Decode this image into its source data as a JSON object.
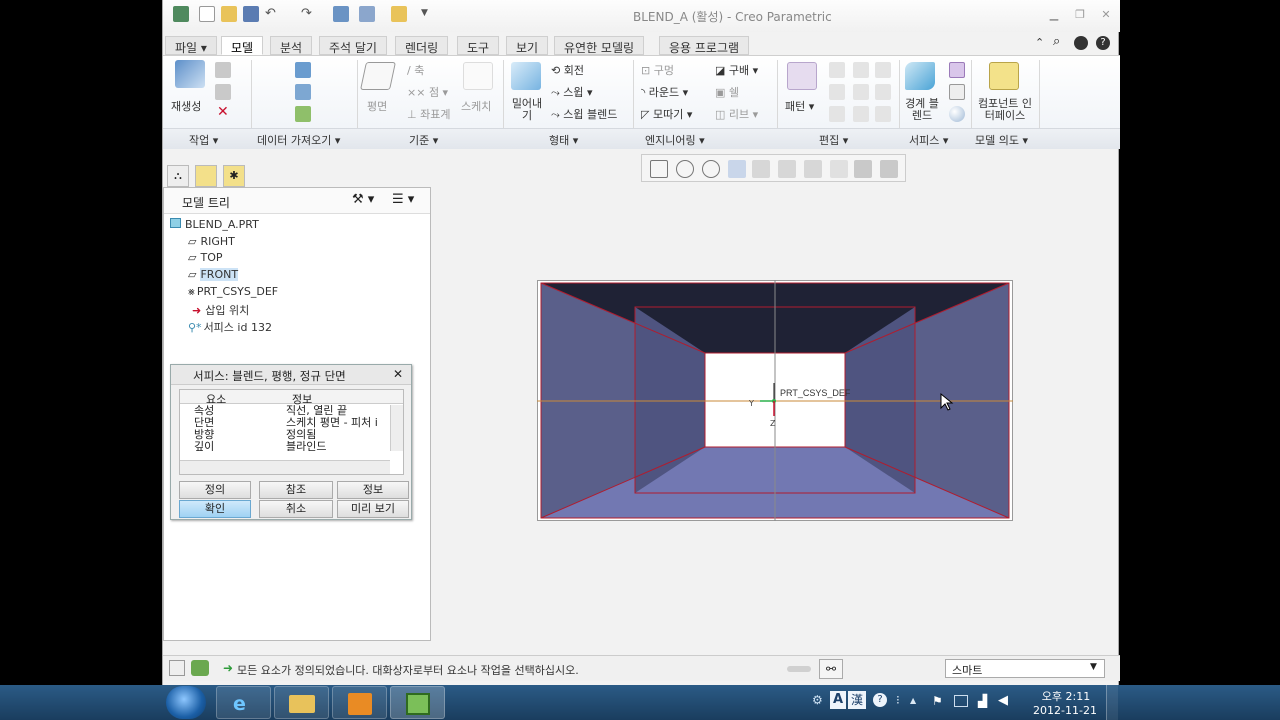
{
  "window": {
    "title": "BLEND_A (활성) - Creo Parametric",
    "controls": [
      "minimize-icon",
      "restore-icon",
      "close-icon"
    ]
  },
  "tabs": {
    "file": "파일",
    "model": "모델",
    "analysis": "분석",
    "annotate": "주석 달기",
    "render": "렌더링",
    "tools": "도구",
    "view": "보기",
    "flexible": "유연한 모델링",
    "apps": "응용 프로그램"
  },
  "ribbon": {
    "regenerate": "재생성",
    "plane": "평면",
    "axis": "축",
    "point": "점",
    "csys": "좌표계",
    "sketch": "스케치",
    "extrude": "밀어내기",
    "revolve": "회전",
    "sweep": "스윕",
    "swept_blend": "스윕 블렌드",
    "hole": "구멍",
    "round": "라운드",
    "chamfer": "모따기",
    "draft": "구배",
    "shell": "쉘",
    "rib": "리브",
    "pattern": "패턴",
    "boundary_blend": "경계 블렌드",
    "component_interface": "컴포넌트 인터페이스",
    "groups": {
      "operations": "작업",
      "get_data": "데이터 가져오기",
      "datum": "기준",
      "shapes": "형태",
      "engineering": "엔지니어링",
      "editing": "편집",
      "surfaces": "서피스",
      "model_intent": "모델 의도"
    }
  },
  "model_tree": {
    "title": "모델 트리",
    "items": [
      "BLEND_A.PRT",
      "RIGHT",
      "TOP",
      "FRONT",
      "PRT_CSYS_DEF",
      "삽입 위치",
      "서피스 id 132"
    ]
  },
  "dialog": {
    "title": "서피스: 블렌드, 평행, 정규 단면",
    "col_element": "요소",
    "col_info": "정보",
    "rows": [
      {
        "element": "속성",
        "info": "직선, 열린 끝"
      },
      {
        "element": "단면",
        "info": "스케치 평면 - 피처 i"
      },
      {
        "element": "방향",
        "info": "정의됨"
      },
      {
        "element": "깊이",
        "info": "블라인드"
      }
    ],
    "buttons": {
      "define": "정의",
      "refs": "참조",
      "info": "정보",
      "ok": "확인",
      "cancel": "취소",
      "preview": "미리 보기"
    }
  },
  "graphics": {
    "csys_label": "PRT_CSYS_DEF",
    "axis_y": "Y",
    "axis_z": "Z"
  },
  "status": {
    "message": "모든 요소가 정의되었습니다. 대화상자로부터 요소나 작업을 선택하십시오.",
    "filter": "스마트"
  },
  "taskbar": {
    "ime_lang": "A",
    "ime_hanja": "漢",
    "time": "오후 2:11",
    "date": "2012-11-21"
  },
  "colors": {
    "face_side": "#5a5f8a",
    "face_top": "#1f2235",
    "face_bottom": "#7278b2",
    "edge": "#b01c2e",
    "accent_blue": "#2f6ea6"
  }
}
